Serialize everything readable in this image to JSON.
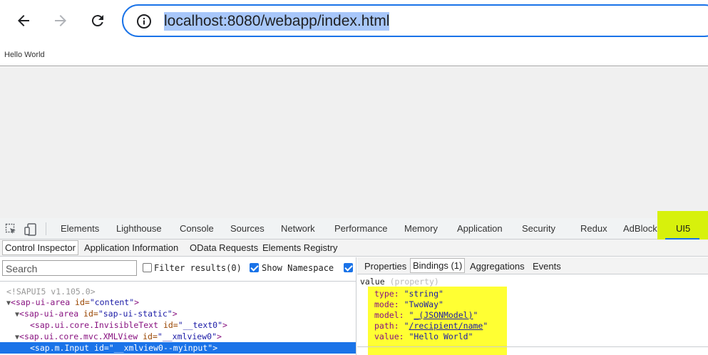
{
  "browser": {
    "url": "localhost:8080/webapp/index.html"
  },
  "page": {
    "content_text": "Hello World"
  },
  "devtools": {
    "tabs": [
      "Elements",
      "Lighthouse",
      "Console",
      "Sources",
      "Network",
      "Performance",
      "Memory",
      "Application",
      "Security",
      "Redux",
      "AdBlock",
      "UI5"
    ],
    "active_tab": "UI5",
    "highlight_color": "#d7f10c"
  },
  "ui5": {
    "sub_tabs": [
      "Control Inspector",
      "Application Information",
      "OData Requests",
      "Elements Registry"
    ],
    "active_sub_tab": "Control Inspector",
    "search_placeholder": "Search",
    "filter_label": "Filter results(0)",
    "show_namespace_label": "Show Namespace",
    "tree": [
      {
        "text": "<!SAPUI5 v1.105.0>"
      },
      {
        "arrow": "▼",
        "tag": "<sap-ui-area",
        "attr": " id=",
        "val": "\"content\"",
        "close": ">"
      },
      {
        "arrow": "▼",
        "tag": "<sap-ui-area",
        "attr": " id=",
        "val": "\"sap-ui-static\"",
        "close": ">"
      },
      {
        "tag": "<sap.ui.core.InvisibleText",
        "attr": " id=",
        "val": "\"__text0\"",
        "close": ">"
      },
      {
        "arrow": "▼",
        "tag": "<sap.ui.core.mvc.XMLView",
        "attr": " id=",
        "val": "\"__xmlview0\"",
        "close": ">"
      },
      {
        "tag": "<sap.m.Input",
        "attr": " id=",
        "val": "\"__xmlview0--myinput\"",
        "close": ">"
      }
    ],
    "right_tabs": [
      "Properties",
      "Bindings (1)",
      "Aggregations",
      "Events"
    ],
    "active_right_tab": "Bindings (1)",
    "binding_property": "value",
    "binding_property_kind": "(property)",
    "binding": {
      "type_key": "type:",
      "type_val": "\"string\"",
      "mode_key": "mode:",
      "mode_val": "\"TwoWay\"",
      "model_key": "model:",
      "model_q1": "\"",
      "model_val": "_(JSONModel)",
      "model_q2": "\"",
      "path_key": "path:",
      "path_q1": "\"",
      "path_val": "/recipient/name",
      "path_q2": "\"",
      "value_key": "value:",
      "value_val": "\"Hello World\""
    },
    "highlight_color": "#ffff33"
  }
}
